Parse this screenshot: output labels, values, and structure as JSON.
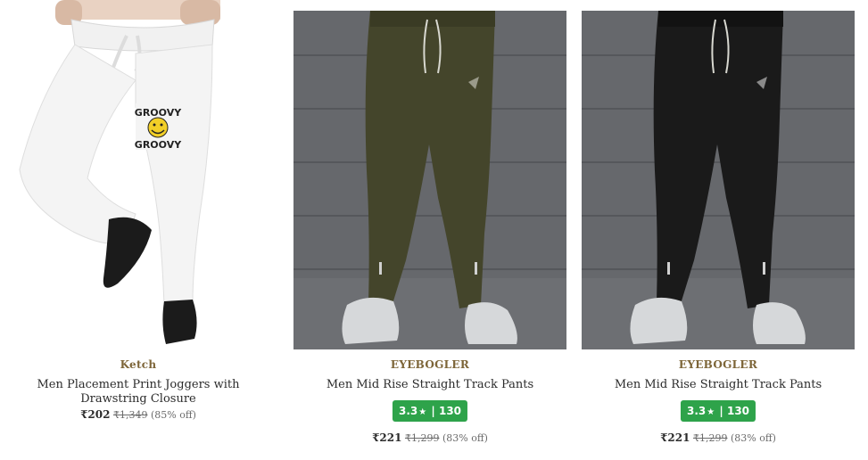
{
  "products": [
    {
      "brand": "Ketch",
      "title": "Men Placement Print Joggers with Drawstring Closure",
      "rating": null,
      "price": "₹202",
      "mrp": "₹1,349",
      "discount": "(85% off)",
      "image_text": [
        "GROOVY",
        "GROOVY"
      ],
      "colors": {
        "pant": "#f4f4f4",
        "background": "#ffffff"
      }
    },
    {
      "brand": "EYEBOGLER",
      "title": "Men Mid Rise Straight Track Pants",
      "rating": {
        "score": "3.3",
        "star": "★",
        "separator": "|",
        "count": "130"
      },
      "price": "₹221",
      "mrp": "₹1,299",
      "discount": "(83% off)",
      "colors": {
        "pant": "#44452b",
        "background": "#5d5f63"
      }
    },
    {
      "brand": "EYEBOGLER",
      "title": "Men Mid Rise Straight Track Pants",
      "rating": {
        "score": "3.3",
        "star": "★",
        "separator": "|",
        "count": "130"
      },
      "price": "₹221",
      "mrp": "₹1,299",
      "discount": "(83% off)",
      "colors": {
        "pant": "#1a1a1a",
        "background": "#5d5f63"
      }
    }
  ],
  "colors": {
    "brand_text": "#7d6538",
    "rating_badge": "#2ea34a"
  }
}
